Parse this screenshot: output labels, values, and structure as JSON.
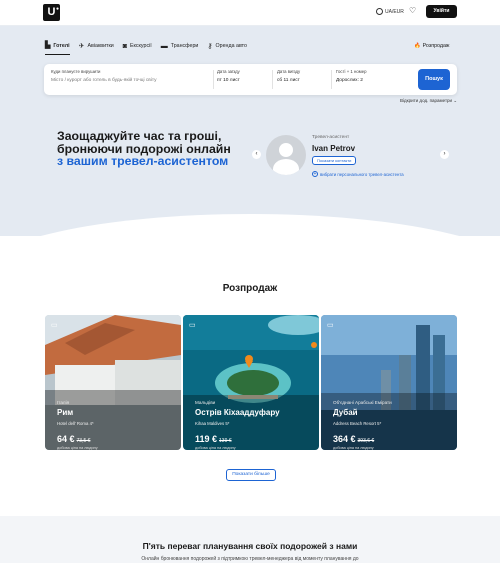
{
  "header": {
    "logo": "U",
    "lang": "UA/EUR",
    "login": "Увійти"
  },
  "tabs": [
    {
      "label": "Готелі",
      "icon": "hotel-icon"
    },
    {
      "label": "Авіаквитки",
      "icon": "plane-icon"
    },
    {
      "label": "Екскурсії",
      "icon": "camera-icon"
    },
    {
      "label": "Трансфери",
      "icon": "car-icon"
    },
    {
      "label": "Оренда авто",
      "icon": "key-icon"
    }
  ],
  "sale_link": "Розпродаж",
  "search": {
    "dest_label": "Куди плануєте вирушити",
    "dest_placeholder": "Місто / курорт або готель в будь-якій точці світу",
    "checkin_label": "Дата заїзду",
    "checkin_value": "пт 10 лист",
    "checkout_label": "Дата виїзду",
    "checkout_value": "сб 11 лист",
    "guests_label": "Гості + 1 номер",
    "guests_value": "Дорослих: 2",
    "button": "Пошук",
    "more": "Відкрити дод. параметри"
  },
  "assistant": {
    "promo_line1": "Заощаджуйте час та гроші,",
    "promo_line2": "бронюючи подорожі онлайн",
    "promo_highlight": "з вашим тревел-асистентом",
    "label": "Тревел-асистент",
    "name": "Ivan Petrov",
    "contact": "Показати контакти",
    "choose": "вибрати персонального тревел-асистента"
  },
  "sales": {
    "title": "Розпродаж",
    "cards": [
      {
        "country": "Італія",
        "city": "Рим",
        "hotel": "Hotel dell' Roma 4*",
        "price": "64 €",
        "old": "73,5 €",
        "per": "добова ціна на людину"
      },
      {
        "country": "Мальдіви",
        "city": "Острів Кіхааддуфару",
        "hotel": "Kihaa Maldives 5*",
        "price": "119 €",
        "old": "139 €",
        "per": "добова ціна на людину"
      },
      {
        "country": "Об'єднані Арабські Емірати",
        "city": "Дубай",
        "hotel": "Address Beach Resort 5*",
        "price": "364 €",
        "old": "393,6 €",
        "per": "добова ціна на людину"
      }
    ],
    "show_more": "Показати більше"
  },
  "advantages": {
    "title": "П'ять переваг планування своїх подорожей з нами",
    "subtitle": "Онлайн бронювання подорожей з підтримкою тревел-менеджера від моменту планування до"
  }
}
